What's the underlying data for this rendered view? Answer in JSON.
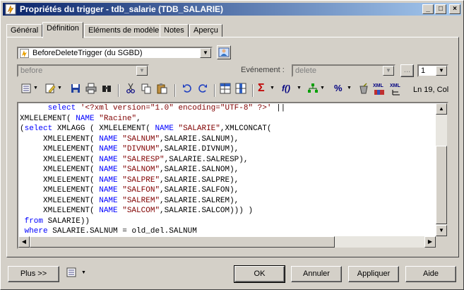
{
  "window": {
    "title": "Propriétés du trigger - tdb_salarie (TDB_SALARIE)"
  },
  "titlebar_buttons": {
    "minimize": "_",
    "maximize": "□",
    "close": "×"
  },
  "tabs": [
    {
      "label": "Général"
    },
    {
      "label": "Définition"
    },
    {
      "label": "Eléments de modèle"
    },
    {
      "label": "Notes"
    },
    {
      "label": "Aperçu"
    }
  ],
  "template": {
    "value": "BeforeDeleteTrigger (du SGBD)"
  },
  "time": {
    "value": "before"
  },
  "event": {
    "label": "Evénement :",
    "value": "delete",
    "ellipsis": "...",
    "order": "1"
  },
  "toolbar": {
    "position": "Ln 19, Col"
  },
  "code_lines": [
    [
      {
        "t": "      "
      },
      {
        "t": "select",
        "k": "kw"
      },
      {
        "t": " "
      },
      {
        "t": "'<?xml version=\"1.0\" encoding=\"UTF-8\" ?>'",
        "k": "str"
      },
      {
        "t": " ||"
      }
    ],
    [
      {
        "t": "XMLELEMENT( "
      },
      {
        "t": "NAME",
        "k": "kw"
      },
      {
        "t": " "
      },
      {
        "t": "\"Racine\"",
        "k": "str"
      },
      {
        "t": ","
      }
    ],
    [
      {
        "t": "("
      },
      {
        "t": "select",
        "k": "kw"
      },
      {
        "t": " XMLAGG ( XMLELEMENT( "
      },
      {
        "t": "NAME",
        "k": "kw"
      },
      {
        "t": " "
      },
      {
        "t": "\"SALARIE\"",
        "k": "str"
      },
      {
        "t": ",XMLCONCAT("
      }
    ],
    [
      {
        "t": "     XMLELEMENT( "
      },
      {
        "t": "NAME",
        "k": "kw"
      },
      {
        "t": " "
      },
      {
        "t": "\"SALNUM\"",
        "k": "str"
      },
      {
        "t": ",SALARIE.SALNUM),"
      }
    ],
    [
      {
        "t": "     XMLELEMENT( "
      },
      {
        "t": "NAME",
        "k": "kw"
      },
      {
        "t": " "
      },
      {
        "t": "\"DIVNUM\"",
        "k": "str"
      },
      {
        "t": ",SALARIE.DIVNUM),"
      }
    ],
    [
      {
        "t": "     XMLELEMENT( "
      },
      {
        "t": "NAME",
        "k": "kw"
      },
      {
        "t": " "
      },
      {
        "t": "\"SALRESP\"",
        "k": "str"
      },
      {
        "t": ",SALARIE.SALRESP),"
      }
    ],
    [
      {
        "t": "     XMLELEMENT( "
      },
      {
        "t": "NAME",
        "k": "kw"
      },
      {
        "t": " "
      },
      {
        "t": "\"SALNOM\"",
        "k": "str"
      },
      {
        "t": ",SALARIE.SALNOM),"
      }
    ],
    [
      {
        "t": "     XMLELEMENT( "
      },
      {
        "t": "NAME",
        "k": "kw"
      },
      {
        "t": " "
      },
      {
        "t": "\"SALPRE\"",
        "k": "str"
      },
      {
        "t": ",SALARIE.SALPRE),"
      }
    ],
    [
      {
        "t": "     XMLELEMENT( "
      },
      {
        "t": "NAME",
        "k": "kw"
      },
      {
        "t": " "
      },
      {
        "t": "\"SALFON\"",
        "k": "str"
      },
      {
        "t": ",SALARIE.SALFON),"
      }
    ],
    [
      {
        "t": "     XMLELEMENT( "
      },
      {
        "t": "NAME",
        "k": "kw"
      },
      {
        "t": " "
      },
      {
        "t": "\"SALREM\"",
        "k": "str"
      },
      {
        "t": ",SALARIE.SALREM),"
      }
    ],
    [
      {
        "t": "     XMLELEMENT( "
      },
      {
        "t": "NAME",
        "k": "kw"
      },
      {
        "t": " "
      },
      {
        "t": "\"SALCOM\"",
        "k": "str"
      },
      {
        "t": ",SALARIE.SALCOM))) )"
      }
    ],
    [
      {
        "t": " "
      },
      {
        "t": "from",
        "k": "kw"
      },
      {
        "t": " SALARIE))"
      }
    ],
    [
      {
        "t": " "
      },
      {
        "t": "where",
        "k": "kw"
      },
      {
        "t": " SALARIE.SALNUM = old_del.SALNUM"
      }
    ]
  ],
  "buttons": {
    "more": "Plus >>",
    "ok": "OK",
    "cancel": "Annuler",
    "apply": "Appliquer",
    "help": "Aide"
  },
  "icons": {
    "sigma": "Σ",
    "fo": "f()",
    "percent": "%",
    "xml1": "XML",
    "xml2": "XML"
  }
}
